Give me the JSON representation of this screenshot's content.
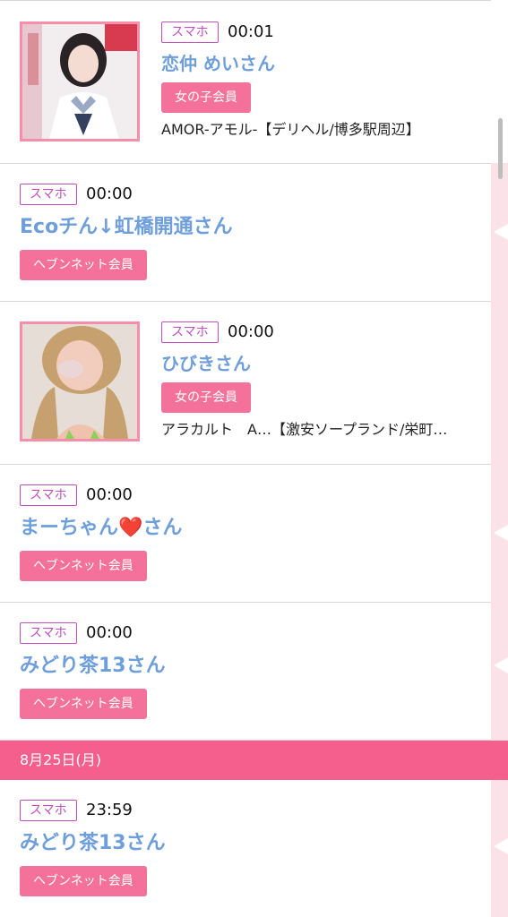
{
  "entries": [
    {
      "device": "スマホ",
      "time": "00:01",
      "name": "恋仲 めいさん",
      "membership": "女の子会員",
      "shop": "AMOR-アモル-【デリヘル/博多駅周辺】"
    },
    {
      "device": "スマホ",
      "time": "00:00",
      "name": "Ecoチん↓虹橋開通さん",
      "membership": "ヘブンネット会員"
    },
    {
      "device": "スマホ",
      "time": "00:00",
      "name": "ひびきさん",
      "membership": "女の子会員",
      "shop": "アラカルト　A…【激安ソープランド/栄町…"
    },
    {
      "device": "スマホ",
      "time": "00:00",
      "name": "まーちゃん❤️さん",
      "membership": "ヘブンネット会員"
    },
    {
      "device": "スマホ",
      "time": "00:00",
      "name": "みどり茶13さん",
      "membership": "ヘブンネット会員"
    },
    {
      "device": "スマホ",
      "time": "23:59",
      "name": "みどり茶13さん",
      "membership": "ヘブンネット会員"
    }
  ],
  "date_divider": "8月25日(月)",
  "colors": {
    "accent_pink": "#f4719b",
    "date_bar": "#f55f8e",
    "device_badge": "#c14fbd",
    "name_blue": "#6f9fda"
  },
  "icons": {
    "rail_marker": "left-pointing-triangle"
  }
}
